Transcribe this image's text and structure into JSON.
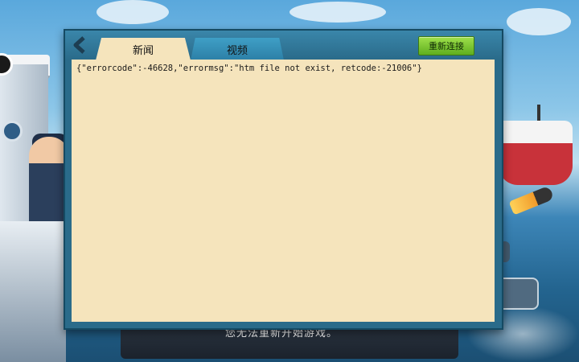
{
  "dialog": {
    "tabs": [
      {
        "label": "新闻"
      },
      {
        "label": "视频"
      }
    ],
    "reconnect_label": "重新连接",
    "content": "{\"errorcode\":-46628,\"errormsg\":\"htm file not exist, retcode:-21006\"}"
  },
  "background": {
    "bottom_text": "您无法重新开始游戏。"
  },
  "icons": {
    "back": "chevron-left-icon"
  },
  "colors": {
    "panel": "#2a6b8a",
    "content_bg": "#f5e4bc",
    "reconnect_green": "#7cc53a"
  }
}
